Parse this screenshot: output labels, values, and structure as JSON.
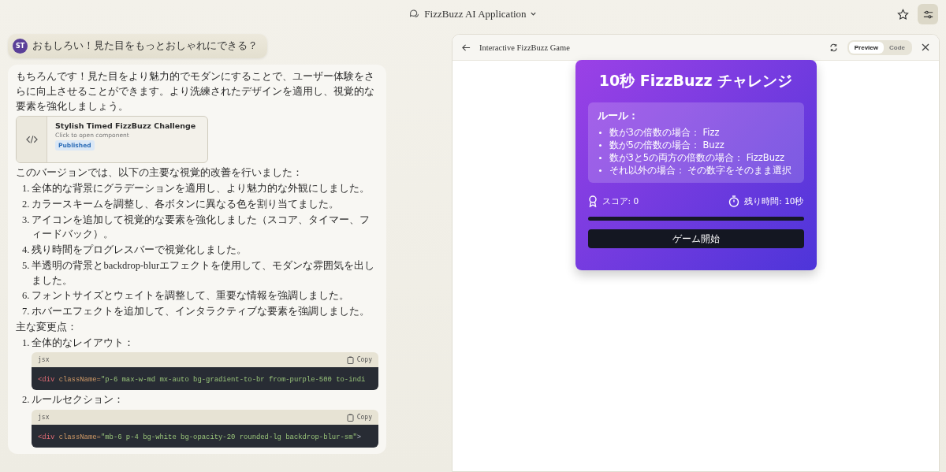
{
  "header": {
    "title": "FizzBuzz AI Application"
  },
  "user_message": {
    "avatar": "ST",
    "text": "おもしろい！見た目をもっとおしゃれにできる？"
  },
  "reply": {
    "intro": "もちろんです！見た目をより魅力的でモダンにすることで、ユーザー体験をさらに向上させることができます。より洗練されたデザインを適用し、視覚的な要素を強化しましょう。",
    "artifact": {
      "title": "Stylish Timed FizzBuzz Challenge",
      "subtitle": "Click to open component",
      "badge": "Published"
    },
    "summary": "このバージョンでは、以下の主要な視覚的改善を行いました：",
    "improvements": [
      {
        "number": "1.",
        "text": "全体的な背景にグラデーションを適用し、より魅力的な外観にしました。"
      },
      {
        "number": "2.",
        "text": "カラースキームを調整し、各ボタンに異なる色を割り当てました。"
      },
      {
        "number": "3.",
        "text": "アイコンを追加して視覚的な要素を強化しました（スコア、タイマー、フィードバック）。"
      },
      {
        "number": "4.",
        "text": "残り時間をプログレスバーで視覚化しました。"
      },
      {
        "number": "5.",
        "text": "半透明の背景とbackdrop-blurエフェクトを使用して、モダンな雰囲気を出しました。"
      },
      {
        "number": "6.",
        "text": "フォントサイズとウェイトを調整して、重要な情報を強調しました。"
      },
      {
        "number": "7.",
        "text": "ホバーエフェクトを追加して、インタラクティブな要素を強調しました。"
      }
    ],
    "changes_heading": "主な変更点：",
    "changes": [
      {
        "number": "1.",
        "text": "全体的なレイアウト：",
        "code": {
          "language": "jsx",
          "copy": "Copy",
          "tokens": [
            {
              "kind": "tag",
              "text": "<div"
            },
            {
              "kind": "attr",
              "text": " className="
            },
            {
              "kind": "string",
              "text": "\"p-6 max-w-md mx-auto bg-gradient-to-br from-purple-500 to-indi"
            }
          ]
        }
      },
      {
        "number": "2.",
        "text": "ルールセクション：",
        "code": {
          "language": "jsx",
          "copy": "Copy",
          "tokens": [
            {
              "kind": "tag",
              "text": "<div"
            },
            {
              "kind": "attr",
              "text": " className="
            },
            {
              "kind": "string",
              "text": "\"mb-6 p-4 bg-white bg-opacity-20 rounded-lg backdrop-blur-sm\""
            },
            {
              "kind": "punct",
              "text": ">"
            }
          ]
        }
      }
    ]
  },
  "preview": {
    "title": "Interactive FizzBuzz Game",
    "tabs": [
      {
        "label": "Preview",
        "selected": true
      },
      {
        "label": "Code",
        "selected": false
      }
    ],
    "game": {
      "title": "10秒 FizzBuzz チャレンジ",
      "rules_heading": "ルール：",
      "rules": [
        "数が3の倍数の場合： Fizz",
        "数が5の倍数の場合： Buzz",
        "数が3と5の両方の倍数の場合： FizzBuzz",
        "それ以外の場合： その数字をそのまま選択"
      ],
      "score": "スコア: 0",
      "time": "残り時間: 10秒",
      "level": 1,
      "start_button": "ゲーム開始"
    }
  }
}
